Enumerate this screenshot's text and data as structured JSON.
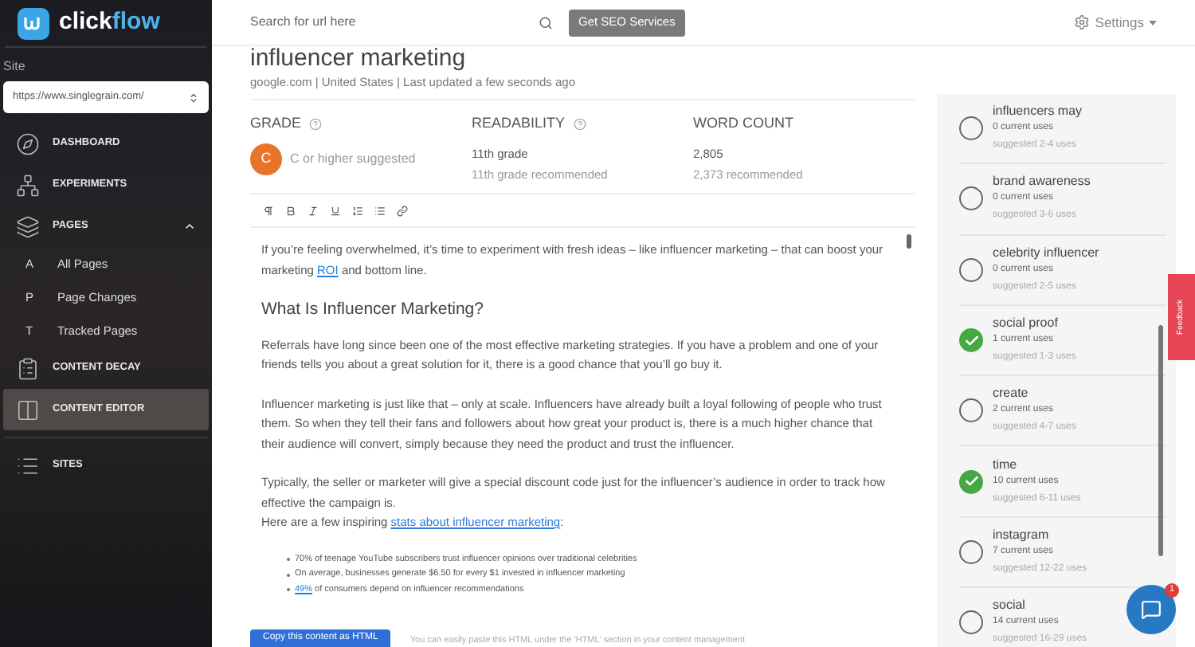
{
  "sidebar": {
    "logo": {
      "part_1": "click",
      "part_2": "flow"
    },
    "site_label": "Site",
    "site_select": "https://www.singlegrain.com/",
    "nav": [
      {
        "kind": "section",
        "label": "DASHBOARD",
        "selected": false
      },
      {
        "kind": "section",
        "label": "EXPERIMENTS",
        "selected": false
      },
      {
        "kind": "section",
        "label": "PAGES",
        "selected": false,
        "expanded": true
      },
      {
        "kind": "sub",
        "letter": "A",
        "label": "All Pages",
        "selected": false
      },
      {
        "kind": "sub",
        "letter": "P",
        "label": "Page Changes",
        "selected": false
      },
      {
        "kind": "sub",
        "letter": "T",
        "label": "Tracked Pages",
        "selected": false
      },
      {
        "kind": "section",
        "label": "CONTENT DECAY",
        "selected": false
      },
      {
        "kind": "section",
        "label": "CONTENT EDITOR",
        "selected": true
      },
      {
        "kind": "divider"
      },
      {
        "kind": "section",
        "label": "SITES",
        "selected": false
      }
    ]
  },
  "topbar": {
    "search": {
      "placeholder": "Search for url here"
    },
    "button": "Get SEO Services",
    "settings": "Settings"
  },
  "document": {
    "title": "influencer marketing",
    "meta": "google.com | United States | Last updated a few seconds ago",
    "metrics": [
      {
        "kind": "grade",
        "label": "GRADE",
        "help": true,
        "badge": "C",
        "value": "C or higher suggested"
      },
      {
        "kind": "text",
        "label": "READABILITY",
        "help": true,
        "value": "11th grade",
        "note": "11th grade recommended"
      },
      {
        "kind": "text",
        "label": "WORD COUNT",
        "help": false,
        "value": "2,805",
        "note": "2,373 recommended"
      }
    ],
    "content": [
      {
        "kind": "paragraph",
        "parts": [
          {
            "text": "If you’re feeling overwhelmed, it’s time to experiment with fresh ideas –  like influencer marketing –  that can boost your marketing ",
            "link": false
          },
          {
            "text": "ROI",
            "link": true
          },
          {
            "text": " and bottom line.",
            "link": false
          }
        ]
      },
      {
        "kind": "heading",
        "text": "What Is Influencer Marketing?"
      },
      {
        "kind": "paragraph",
        "parts": [
          {
            "text": "Referrals have long since been one of the most effective marketing strategies. If you have a problem and one of your friends tells you about a great solution for it, there is a good chance that you’ll go buy it.",
            "link": false
          }
        ]
      },
      {
        "kind": "paragraph",
        "parts": [
          {
            "text": "Influencer marketing is just like that –  only at scale. Influencers have already built a loyal following of people who trust them. So when they tell their fans and followers about how great your product is, there is a much higher chance that their audience will convert, simply because they need the product and trust the influencer.",
            "link": false
          }
        ]
      },
      {
        "kind": "tight",
        "parts": [
          {
            "text": "Typically, the seller or marketer will give a special discount code just for the influencer’s audience in order to track how effective the campaign is.",
            "link": false
          }
        ]
      },
      {
        "kind": "paragraph",
        "parts": [
          {
            "text": "Here are a few inspiring ",
            "link": false
          },
          {
            "text": "stats about influencer marketing",
            "link": true
          },
          {
            "text": ":",
            "link": false
          }
        ]
      },
      {
        "kind": "list",
        "items": [
          [
            {
              "text": "70% of teenage YouTube subscribers trust influencer opinions over traditional celebrities",
              "link": false
            }
          ],
          [
            {
              "text": "On average, businesses generate $6.50 for every $1 invested in influencer marketing",
              "link": false
            }
          ],
          [
            {
              "text": "49%",
              "link": true
            },
            {
              "text": " of consumers depend on influencer recommendations",
              "link": false
            }
          ]
        ]
      }
    ],
    "copy_button": "Copy this content as HTML",
    "copy_note": "You can easily paste this HTML under the 'HTML' section in your content management"
  },
  "keywords": [
    {
      "term": "influencers may",
      "current": "0 current uses",
      "suggested": "suggested 2-4 uses",
      "done": false
    },
    {
      "term": "brand awareness",
      "current": "0 current uses",
      "suggested": "suggested 3-6 uses",
      "done": false
    },
    {
      "term": "celebrity influencer",
      "current": "0 current uses",
      "suggested": "suggested 2-5 uses",
      "done": false
    },
    {
      "term": "social proof",
      "current": "1 current uses",
      "suggested": "suggested 1-3 uses",
      "done": true
    },
    {
      "term": "create",
      "current": "2 current uses",
      "suggested": "suggested 4-7 uses",
      "done": false
    },
    {
      "term": "time",
      "current": "10 current uses",
      "suggested": "suggested 6-11 uses",
      "done": true
    },
    {
      "term": "instagram",
      "current": "7 current uses",
      "suggested": "suggested 12-22 uses",
      "done": false
    },
    {
      "term": "social",
      "current": "14 current uses",
      "suggested": "suggested 16-29 uses",
      "done": false
    }
  ],
  "feedback_tab": "Feedback",
  "chat": {
    "badge": "1"
  }
}
